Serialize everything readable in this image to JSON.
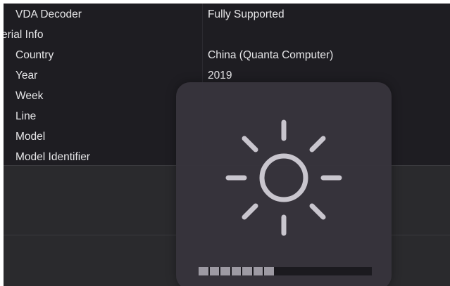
{
  "info_rows": [
    {
      "key": "vda_decoder",
      "label": "VDA Decoder",
      "value": "Fully Supported",
      "level": "indent"
    },
    {
      "key": "serial_info",
      "label": "erial Info",
      "value": "",
      "level": "section"
    },
    {
      "key": "country",
      "label": "Country",
      "value": "China (Quanta Computer)",
      "level": "indent"
    },
    {
      "key": "year",
      "label": "Year",
      "value": "2019",
      "level": "indent"
    },
    {
      "key": "week",
      "label": "Week",
      "value": "",
      "level": "indent"
    },
    {
      "key": "line",
      "label": "Line",
      "value": "",
      "level": "indent"
    },
    {
      "key": "model",
      "label": "Model",
      "value": "",
      "level": "indent"
    },
    {
      "key": "model_identifier",
      "label": "Model Identifier",
      "value": "",
      "level": "indent"
    }
  ],
  "brightness_hud": {
    "icon": "sun-brightness-icon",
    "level_segments_total": 16,
    "level_segments_filled": 7,
    "level_fraction": 0.4375
  },
  "colors": {
    "background": "#252528",
    "panel": "#1e1d22",
    "hud": "#37343c",
    "icon": "#c9c6ce",
    "level_fill": "#9d9aa3"
  }
}
